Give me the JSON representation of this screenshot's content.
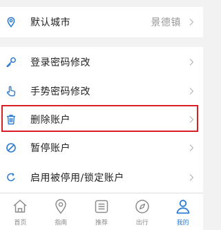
{
  "colors": {
    "accent": "#2b7bd1",
    "highlight": "#d91e24",
    "text": "#222222",
    "muted": "#9a9a9a"
  },
  "city_row": {
    "label": "默认城市",
    "value": "景德镇",
    "icon": "location-pin-icon"
  },
  "menu": [
    {
      "label": "登录密码修改",
      "icon": "key-icon"
    },
    {
      "label": "手势密码修改",
      "icon": "hand-pointer-icon"
    },
    {
      "label": "删除账户",
      "icon": "trash-icon",
      "highlighted": true
    },
    {
      "label": "暂停账户",
      "icon": "block-icon"
    },
    {
      "label": "启用被停用/锁定账户",
      "icon": "refresh-icon"
    }
  ],
  "tabs": [
    {
      "label": "首页",
      "icon": "home-icon"
    },
    {
      "label": "指南",
      "icon": "location-icon"
    },
    {
      "label": "推荐",
      "icon": "list-icon"
    },
    {
      "label": "出行",
      "icon": "compass-icon"
    },
    {
      "label": "我的",
      "icon": "user-icon",
      "active": true
    }
  ]
}
